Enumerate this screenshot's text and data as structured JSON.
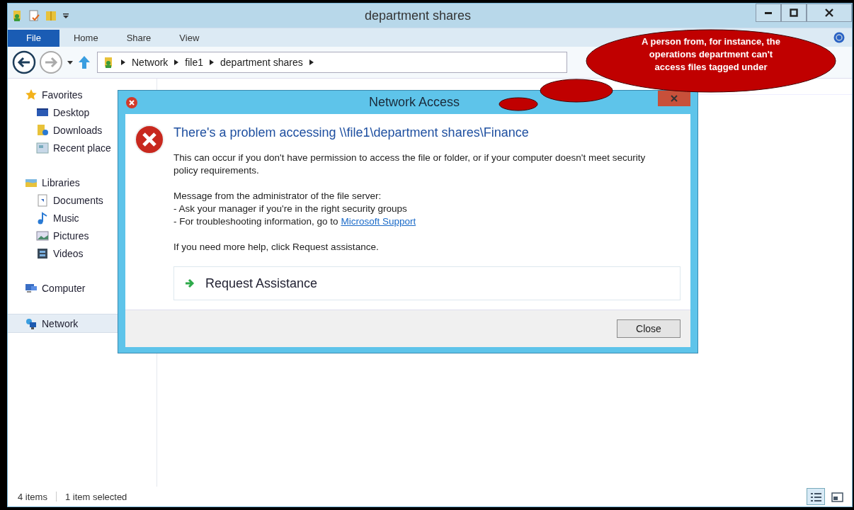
{
  "window": {
    "title": "department shares"
  },
  "ribbon_tabs": [
    {
      "label": "File",
      "kind": "file",
      "selected": false
    },
    {
      "label": "Home",
      "kind": "tab",
      "selected": false
    },
    {
      "label": "Share",
      "kind": "tab",
      "selected": false
    },
    {
      "label": "View",
      "kind": "tab",
      "selected": false
    }
  ],
  "address": {
    "crumbs": [
      "Network",
      "file1",
      "department shares"
    ]
  },
  "sidebar": {
    "items": [
      {
        "label": "Favorites",
        "selected": false,
        "children": [
          {
            "label": "Desktop",
            "selected": false
          },
          {
            "label": "Downloads",
            "selected": false
          },
          {
            "label": "Recent place",
            "selected": false
          }
        ]
      },
      {
        "label": "Libraries",
        "selected": false,
        "children": [
          {
            "label": "Documents",
            "selected": false
          },
          {
            "label": "Music",
            "selected": false
          },
          {
            "label": "Pictures",
            "selected": false
          },
          {
            "label": "Videos",
            "selected": false
          }
        ]
      },
      {
        "label": "Computer",
        "selected": false
      },
      {
        "label": "Network",
        "selected": true
      }
    ]
  },
  "status_bar": {
    "item_count": "4 items",
    "selection": "1 item selected",
    "views": [
      {
        "selected": true
      },
      {
        "selected": false
      }
    ]
  },
  "dialog": {
    "title": "Network Access",
    "heading": "There's a problem accessing \\\\file1\\department shares\\Finance",
    "explanation": "This can occur if you don't have permission to access the file or folder, or if your computer doesn't meet security policy requirements.",
    "admin_intro": "Message from the administrator of the file server:",
    "admin_lines": [
      {
        "text": "- Ask your manager if you're in the right security groups"
      },
      {
        "text": "- For troubleshooting information, go to ",
        "link": "Microsoft Support"
      }
    ],
    "help": "If you need more help, click Request assistance.",
    "command_link": "Request Assistance",
    "buttons": [
      "Close"
    ]
  },
  "callout": {
    "text": "A person from, for instance, the operations department can't access files tagged under"
  }
}
